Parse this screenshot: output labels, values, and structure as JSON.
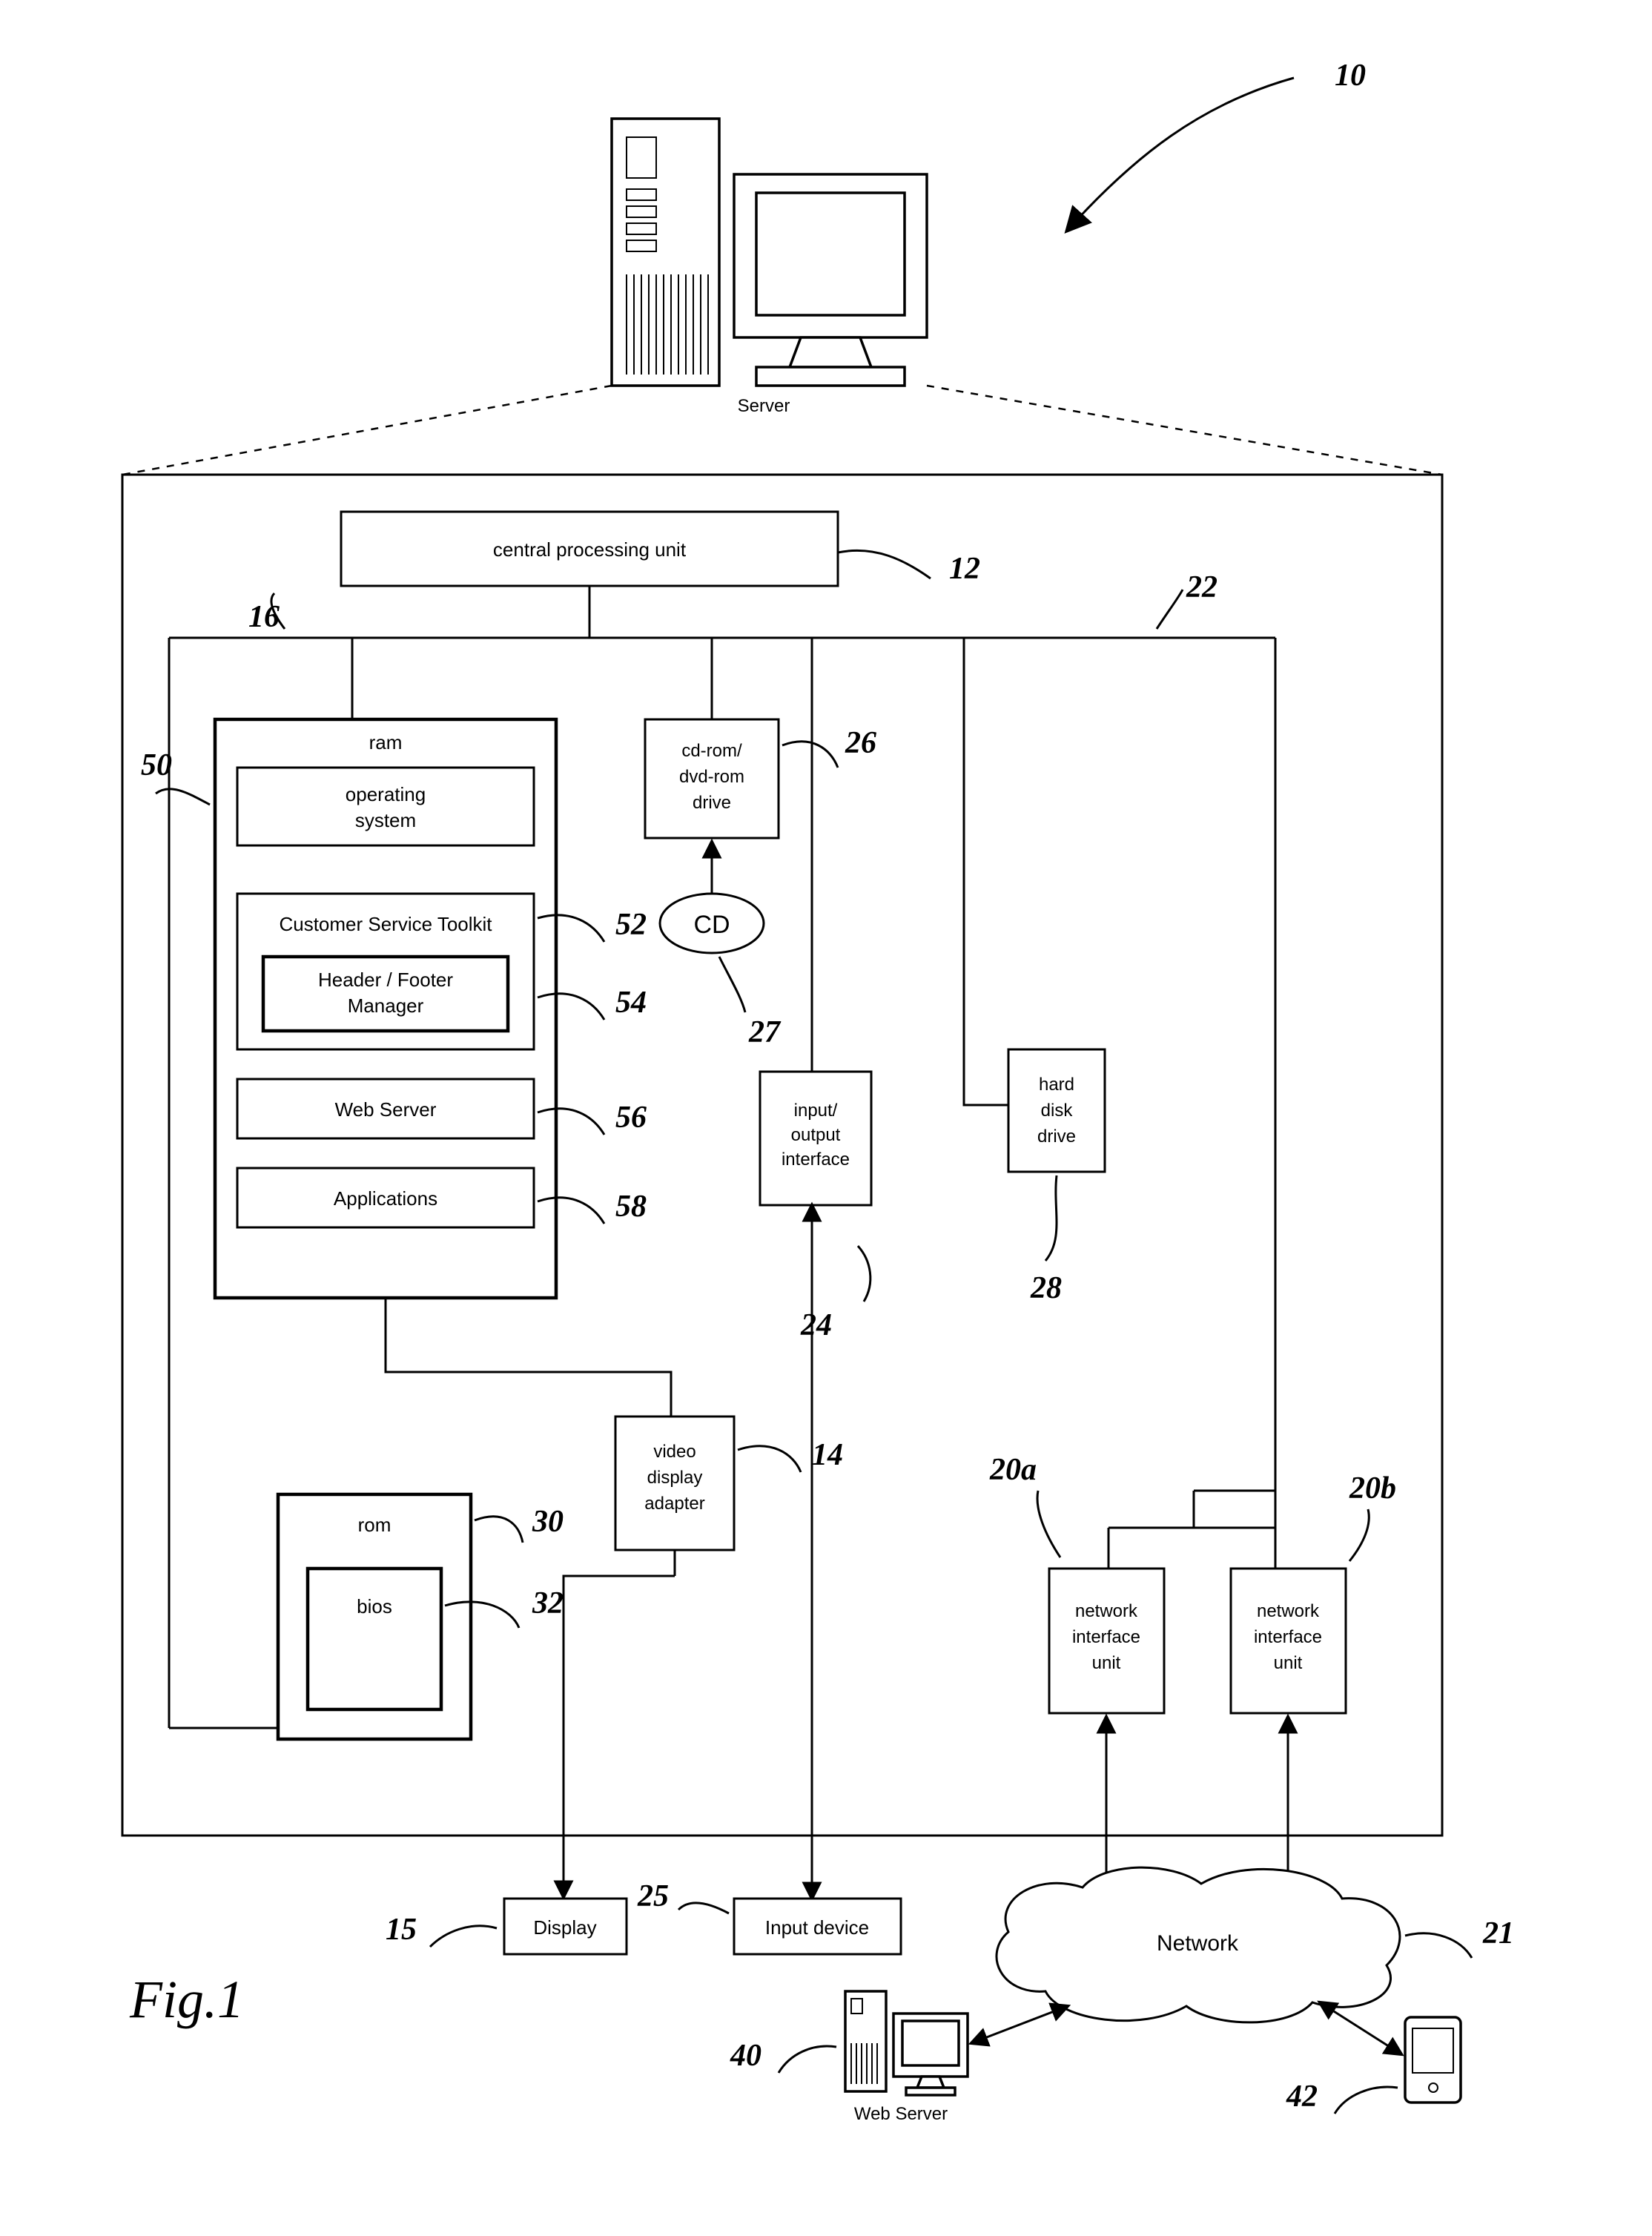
{
  "figure": "Fig.1",
  "serverCaption": "Server",
  "webServerCaption": "Web Server",
  "blocks": {
    "cpu": "central processing unit",
    "ram": "ram",
    "os1": "operating",
    "os2": "system",
    "cst": "Customer Service Toolkit",
    "hfm1": "Header / Footer",
    "hfm2": "Manager",
    "ws": "Web Server",
    "apps": "Applications",
    "cd1": "cd-rom/",
    "cd2": "dvd-rom",
    "cd3": "drive",
    "cdDisc": "CD",
    "io1": "input/",
    "io2": "output",
    "io3": "interface",
    "hdd1": "hard",
    "hdd2": "disk",
    "hdd3": "drive",
    "vda1": "video",
    "vda2": "display",
    "vda3": "adapter",
    "rom": "rom",
    "bios": "bios",
    "niu1a": "network",
    "niu1b": "interface",
    "niu1c": "unit",
    "display": "Display",
    "inputDevice": "Input device",
    "network": "Network"
  },
  "refs": {
    "r10": "10",
    "r12": "12",
    "r14": "14",
    "r15": "15",
    "r16": "16",
    "r20a": "20a",
    "r20b": "20b",
    "r21": "21",
    "r22": "22",
    "r24": "24",
    "r25": "25",
    "r26": "26",
    "r27": "27",
    "r28": "28",
    "r30": "30",
    "r32": "32",
    "r40": "40",
    "r42": "42",
    "r50": "50",
    "r52": "52",
    "r54": "54",
    "r56": "56",
    "r58": "58"
  }
}
